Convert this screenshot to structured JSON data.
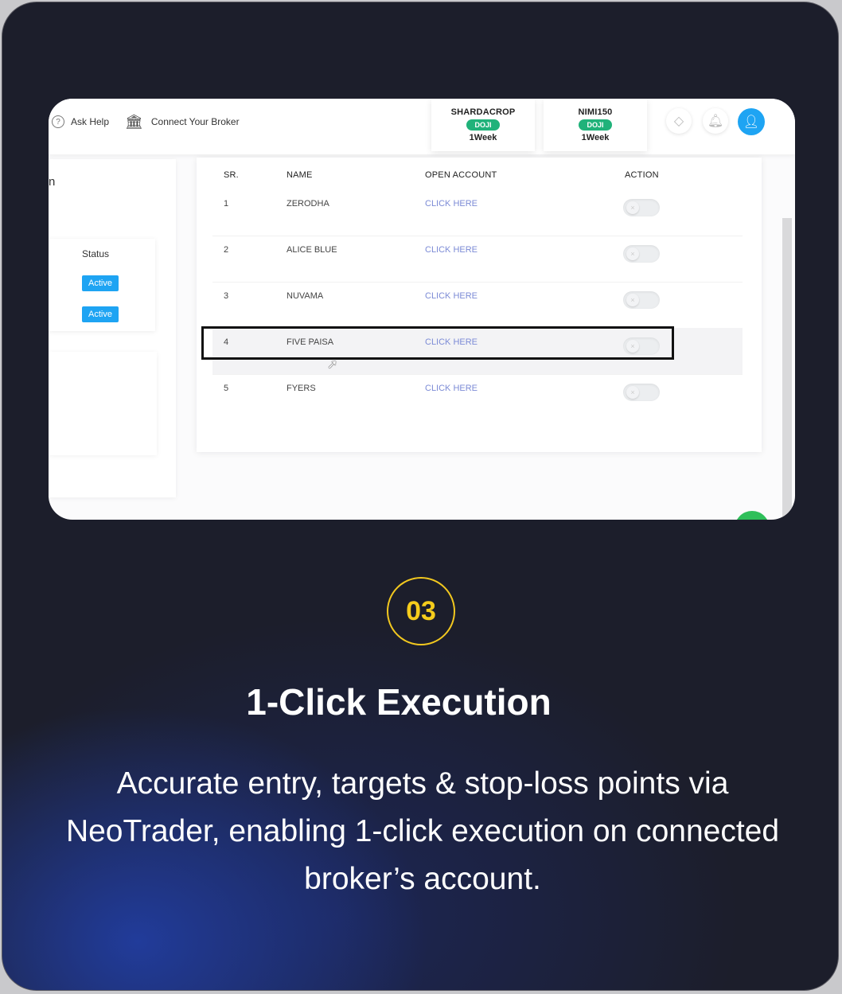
{
  "colors": {
    "accent_yellow": "#f5cc1c",
    "link_blue": "#7c8bd6",
    "badge_blue": "#1ea4f3",
    "doji_green": "#20b27a",
    "card_bg": "#1c1e2b"
  },
  "topbar": {
    "ask_help": "Ask Help",
    "connect_broker": "Connect Your Broker",
    "stocks": [
      {
        "name": "SHARDACROP",
        "tag": "DOJI",
        "period": "1Week"
      },
      {
        "name": "NIMI150",
        "tag": "DOJI",
        "period": "1Week"
      }
    ],
    "icons": [
      "diamond-icon",
      "bell-icon",
      "user-icon"
    ]
  },
  "leftpanel": {
    "partial_title": "n",
    "status_header": "Status",
    "statuses": [
      "Active",
      "Active"
    ]
  },
  "table": {
    "headers": {
      "sr": "SR.",
      "name": "NAME",
      "open_account": "OPEN ACCOUNT",
      "action": "ACTION"
    },
    "rows": [
      {
        "sr": "1",
        "name": "ZERODHA",
        "link": "CLICK HERE"
      },
      {
        "sr": "2",
        "name": "ALICE BLUE",
        "link": "CLICK HERE"
      },
      {
        "sr": "3",
        "name": "NUVAMA",
        "link": "CLICK HERE"
      },
      {
        "sr": "4",
        "name": "FIVE PAISA",
        "link": "CLICK HERE"
      },
      {
        "sr": "5",
        "name": "FYERS",
        "link": "CLICK HERE"
      }
    ],
    "highlighted_row": "4"
  },
  "feature": {
    "number": "03",
    "title": "1-Click Execution",
    "description": "Accurate entry, targets & stop-loss points via NeoTrader, enabling 1-click execution on connected broker’s account."
  }
}
